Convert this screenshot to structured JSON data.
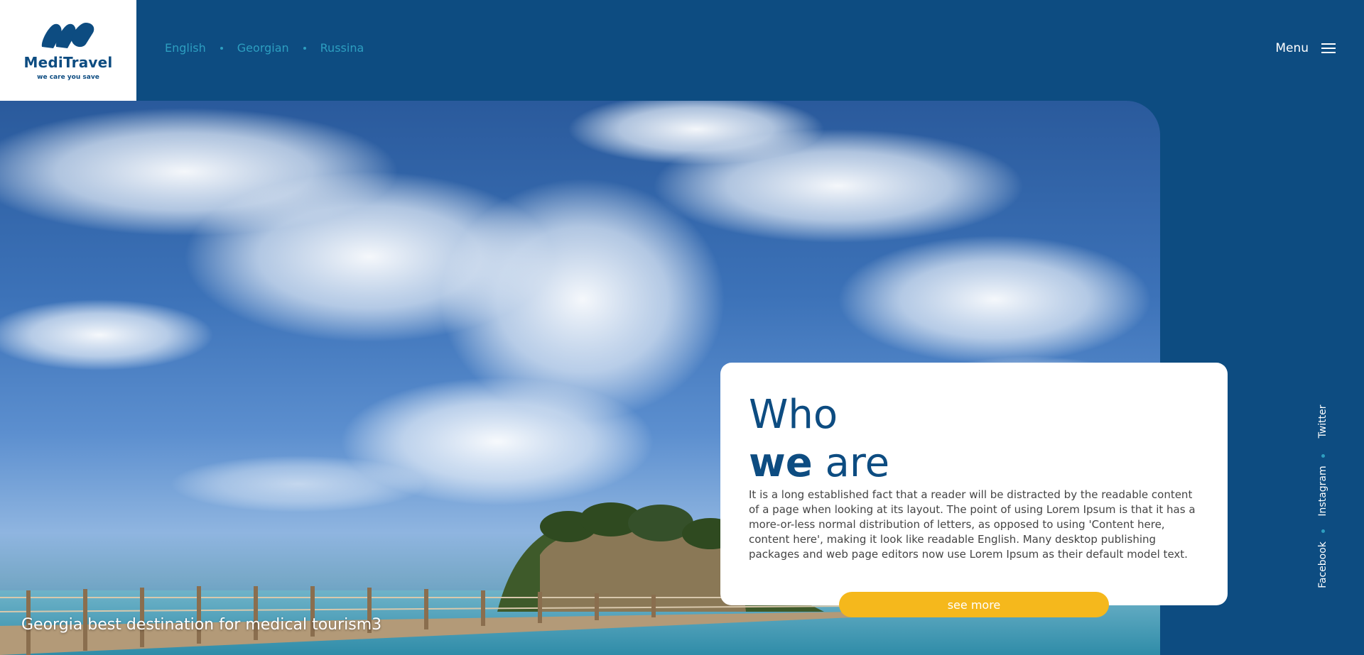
{
  "brand": {
    "name": "MediTravel",
    "tagline": "we care you save"
  },
  "languages": [
    "English",
    "Georgian",
    "Russina"
  ],
  "menu": {
    "label": "Menu"
  },
  "hero": {
    "caption": "Georgia best destination for medical tourism3"
  },
  "about": {
    "title_line1": "Who",
    "title_bold": "we",
    "title_rest": " are",
    "body": "It is a long established fact that a reader will be distracted by the readable content of a page when looking at its layout. The point of using Lorem Ipsum is that it has a more-or-less normal distribution of letters, as opposed to using 'Content here, content here', making it look like readable English. Many desktop publishing packages and web page editors now use Lorem Ipsum as their default model text.",
    "button_label": "see more"
  },
  "social": [
    "Twitter",
    "Instagram",
    "Facebook"
  ],
  "colors": {
    "background": "#0d4c81",
    "accent": "#2d9ec0",
    "button": "#f5b81c"
  }
}
